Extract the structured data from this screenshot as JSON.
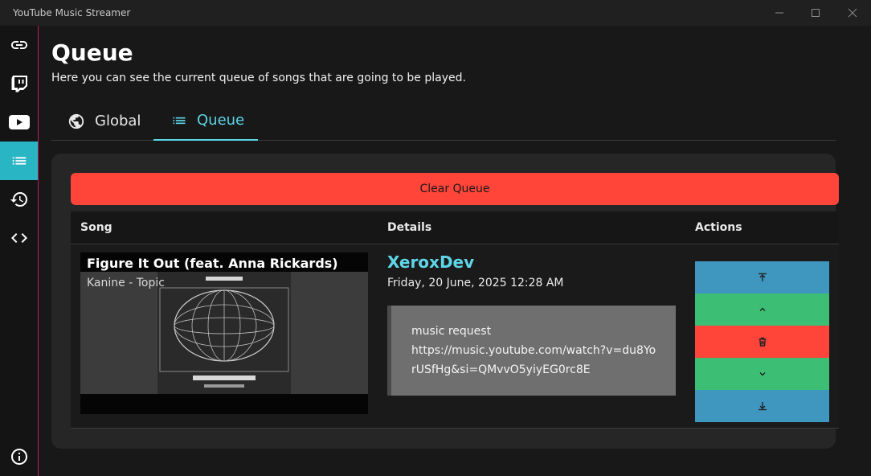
{
  "window": {
    "title": "YouTube Music Streamer"
  },
  "sidebar": {
    "items": [
      {
        "icon": "link-icon"
      },
      {
        "icon": "twitch-icon"
      },
      {
        "icon": "youtube-icon"
      },
      {
        "icon": "queue-list-icon",
        "active": true
      },
      {
        "icon": "history-icon"
      },
      {
        "icon": "code-icon"
      },
      {
        "icon": "info-icon"
      }
    ]
  },
  "page": {
    "title": "Queue",
    "subtitle": "Here you can see the current queue of songs that are going to be played."
  },
  "tabs": [
    {
      "label": "Global",
      "icon": "globe-icon",
      "active": false
    },
    {
      "label": "Queue",
      "icon": "list-icon",
      "active": true
    }
  ],
  "queue": {
    "clear_label": "Clear Queue",
    "columns": [
      "Song",
      "Details",
      "Actions"
    ],
    "rows": [
      {
        "song_title": "Figure It Out (feat. Anna Rickards)",
        "artist": "Kanine - Topic",
        "requested_by": "XeroxDev",
        "date": "Friday, 20 June, 2025 12:28 AM",
        "message_line1": "music request",
        "message_line2": "https://music.youtube.com/watch?v=du8YorUSfHg&si=QMvvO5yiyEG0rc8E",
        "actions": [
          {
            "name": "move-to-top",
            "icon": "arrow-to-top-icon",
            "color": "#3f97c0"
          },
          {
            "name": "move-up",
            "icon": "chevron-up-icon",
            "color": "#3cbf74"
          },
          {
            "name": "delete",
            "icon": "trash-icon",
            "color": "#ff443a"
          },
          {
            "name": "move-down",
            "icon": "chevron-down-icon",
            "color": "#3cbf74"
          },
          {
            "name": "move-to-bottom",
            "icon": "arrow-to-bottom-icon",
            "color": "#3f97c0"
          }
        ]
      }
    ]
  },
  "colors": {
    "accent": "#5ed6e8",
    "sidebar_active": "#2ab5c5",
    "danger": "#ff443a",
    "success": "#3cbf74",
    "info": "#3f97c0"
  }
}
